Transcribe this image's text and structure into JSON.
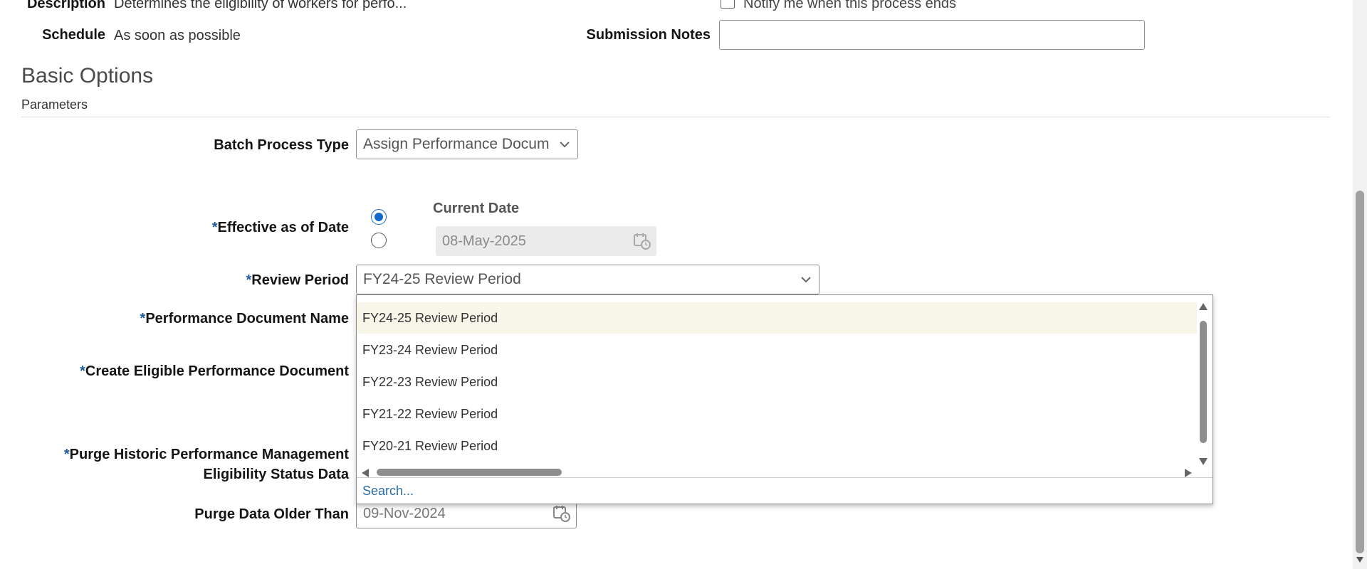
{
  "header": {
    "description_label": "Description",
    "description_value": "Determines the eligibility of workers for perfo...",
    "schedule_label": "Schedule",
    "schedule_value": "As soon as possible",
    "notify_label": "Notify me when this process ends",
    "submission_notes_label": "Submission Notes",
    "submission_notes_value": ""
  },
  "basic_options": {
    "title": "Basic Options",
    "parameters_label": "Parameters"
  },
  "form": {
    "required_marker": "*",
    "batch_process_type_label": "Batch Process Type",
    "batch_process_type_value": "Assign Performance Docum",
    "effective_date_label": "Effective as of Date",
    "current_date_label": "Current Date",
    "effective_date_value": "08-May-2025",
    "review_period_label": "Review Period",
    "review_period_value": "FY24-25 Review Period",
    "performance_document_name_label": "Performance Document Name",
    "create_eligible_label": "Create Eligible Performance Document",
    "purge_historic_label_line1": "Purge Historic Performance Management",
    "purge_historic_label_line2": "Eligibility Status Data",
    "purge_older_than_label": "Purge Data Older Than",
    "purge_older_than_value": "09-Nov-2024"
  },
  "review_period_dropdown": {
    "options": [
      "FY24-25 Review Period",
      "FY23-24 Review Period",
      "FY22-23 Review Period",
      "FY21-22 Review Period",
      "FY20-21 Review Period"
    ],
    "highlighted_index": 0,
    "search_link": "Search..."
  },
  "icons": {
    "calendar": "calendar-clock-icon",
    "chevron": "chevron-down-icon"
  },
  "colors": {
    "required": "#1a5c9e",
    "radio_selected": "#1468c9",
    "highlight_row": "#f7f6e8",
    "link": "#2c6ea3"
  }
}
